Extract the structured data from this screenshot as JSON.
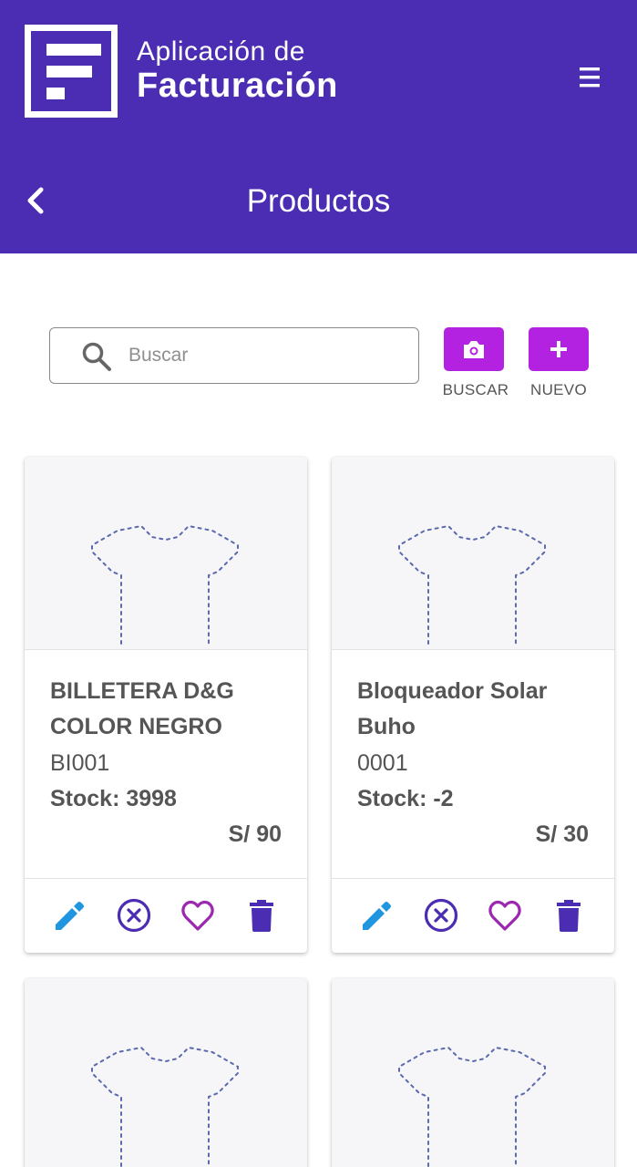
{
  "header": {
    "app_name_line1": "Aplicación de",
    "app_name_line2": "Facturación",
    "page_title": "Productos",
    "color": "#4b2db3"
  },
  "search": {
    "placeholder": "Buscar",
    "value": ""
  },
  "actions": {
    "scan_label": "BUSCAR",
    "new_label": "NUEVO",
    "color": "#b222e0"
  },
  "products": [
    {
      "name": "BILLETERA D&G COLOR NEGRO",
      "code": "BI001",
      "stock": "Stock: 3998",
      "price": "S/ 90"
    },
    {
      "name": "Bloqueador Solar Buho",
      "code": "0001",
      "stock": "Stock: -2",
      "price": "S/ 30"
    }
  ],
  "card_actions": {
    "icons": [
      "edit-icon",
      "cancel-icon",
      "favorite-icon",
      "delete-icon"
    ],
    "colors": {
      "edit": "#2196e0",
      "cancel": "#4b2db3",
      "favorite": "#9c27b0",
      "delete": "#4b2db3"
    }
  }
}
